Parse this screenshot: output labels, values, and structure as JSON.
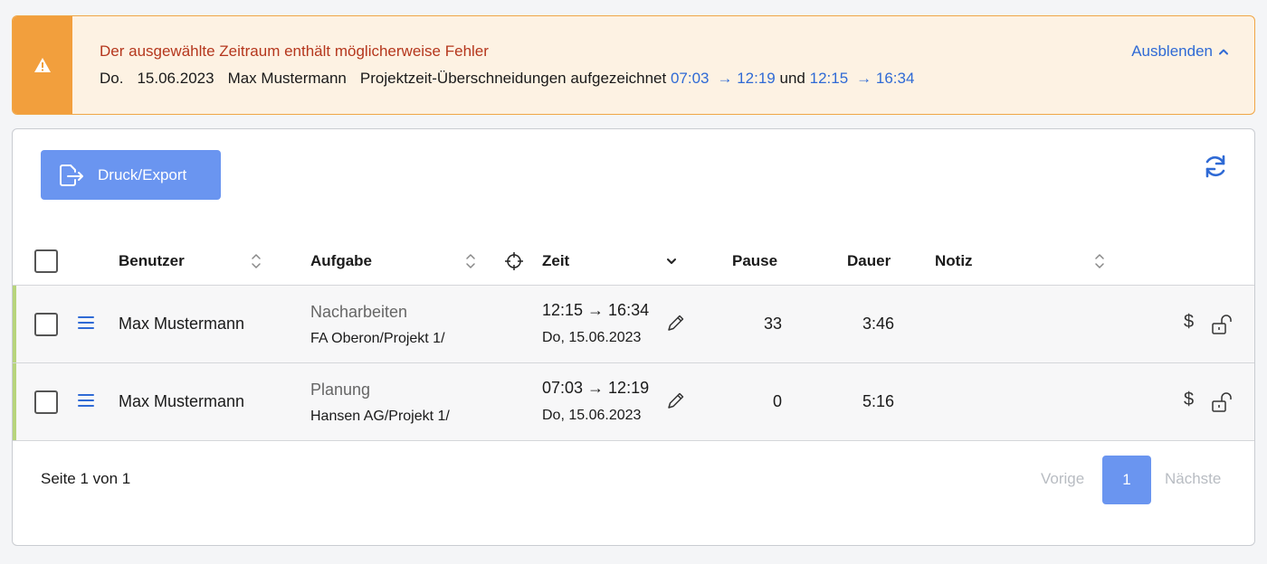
{
  "alert": {
    "title": "Der ausgewählte Zeitraum enthält möglicherweise Fehler",
    "day": "Do.",
    "date": "15.06.2023",
    "user": "Max Mustermann",
    "message": "Projektzeit-Überschneidungen aufgezeichnet",
    "range1_start": "07:03",
    "range1_end": "→ 12:19",
    "connector": "und",
    "range2_start": "12:15",
    "range2_end": "→ 16:34",
    "hide_label": "Ausblenden",
    "accent_color": "#f29f3d"
  },
  "toolbar": {
    "export_label": "Druck/Export"
  },
  "table": {
    "columns": {
      "user": "Benutzer",
      "task": "Aufgabe",
      "time": "Zeit",
      "pause": "Pause",
      "duration": "Dauer",
      "note": "Notiz"
    },
    "rows": [
      {
        "user": "Max Mustermann",
        "task": "Nacharbeiten",
        "project": "FA Oberon/Projekt 1/",
        "time": "12:15 → 16:34",
        "date": "Do, 15.06.2023",
        "pause": "33",
        "duration": "3:46",
        "note": "",
        "billable_icon": "$"
      },
      {
        "user": "Max Mustermann",
        "task": "Planung",
        "project": "Hansen AG/Projekt 1/",
        "time": "07:03 → 12:19",
        "date": "Do, 15.06.2023",
        "pause": "0",
        "duration": "5:16",
        "note": "",
        "billable_icon": "$"
      }
    ]
  },
  "pagination": {
    "info": "Seite 1 von 1",
    "prev": "Vorige",
    "current": "1",
    "next": "Nächste"
  }
}
